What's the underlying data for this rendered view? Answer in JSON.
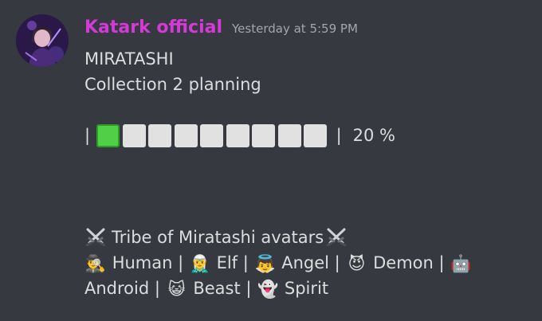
{
  "message": {
    "author": "Katark official",
    "author_color": "#d43ad8",
    "timestamp": "Yesterday at 5:59 PM",
    "lines": {
      "title": "MIRATASHI",
      "subtitle": "Collection 2 planning",
      "section_title": "Tribe of Miratashi avatars"
    },
    "progress": {
      "left_pipe": "|",
      "right_pipe": "|",
      "filled_squares": 1,
      "total_squares": 9,
      "percent_text": "20 %",
      "filled_color": "#4fd046",
      "empty_color": "#e1e1e1"
    },
    "tribes": [
      {
        "emoji": "🕵️‍♂️",
        "icon": "detective-icon",
        "label": "Human"
      },
      {
        "emoji": "🧝‍♂️",
        "icon": "elf-icon",
        "label": "Elf"
      },
      {
        "emoji": "👼",
        "icon": "angel-icon",
        "label": "Angel"
      },
      {
        "emoji": "😈",
        "icon": "devil-icon",
        "label": "Demon"
      },
      {
        "emoji": "🤖",
        "icon": "robot-icon",
        "label": "Android"
      },
      {
        "emoji": "😺",
        "icon": "cat-icon",
        "label": "Beast"
      },
      {
        "emoji": "👻",
        "icon": "ghost-icon",
        "label": "Spirit"
      }
    ],
    "separator": "|"
  }
}
